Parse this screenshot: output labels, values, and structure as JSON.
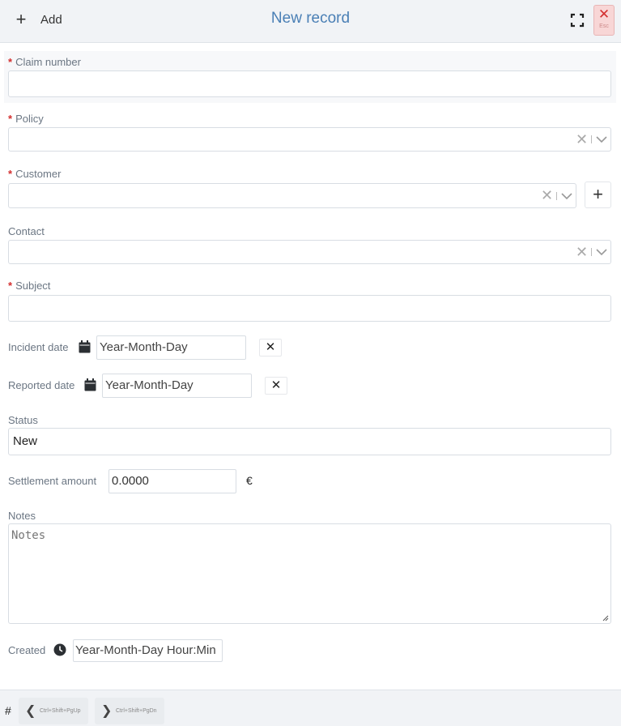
{
  "header": {
    "add_label": "Add",
    "title": "New record",
    "close_hint": "Esc"
  },
  "form": {
    "claim_number_label": "Claim number",
    "policy_label": "Policy",
    "customer_label": "Customer",
    "contact_label": "Contact",
    "subject_label": "Subject",
    "incident_date_label": "Incident date",
    "incident_date_placeholder": "Year-Month-Day",
    "reported_date_label": "Reported date",
    "reported_date_placeholder": "Year-Month-Day",
    "status_label": "Status",
    "status_value": "New",
    "settlement_label": "Settlement amount",
    "settlement_value": "0.0000",
    "currency": "€",
    "notes_label": "Notes",
    "notes_placeholder": "Notes",
    "created_label": "Created",
    "created_placeholder": "Year-Month-Day Hour:Min"
  },
  "footer": {
    "hash": "#",
    "prev_hint": "Ctrl+Shift+PgUp",
    "next_hint": "Ctrl+Shift+PgDn"
  },
  "colors": {
    "title": "#4a7fb5",
    "required": "#d32f2f",
    "close_bg": "#f8d6d6"
  }
}
